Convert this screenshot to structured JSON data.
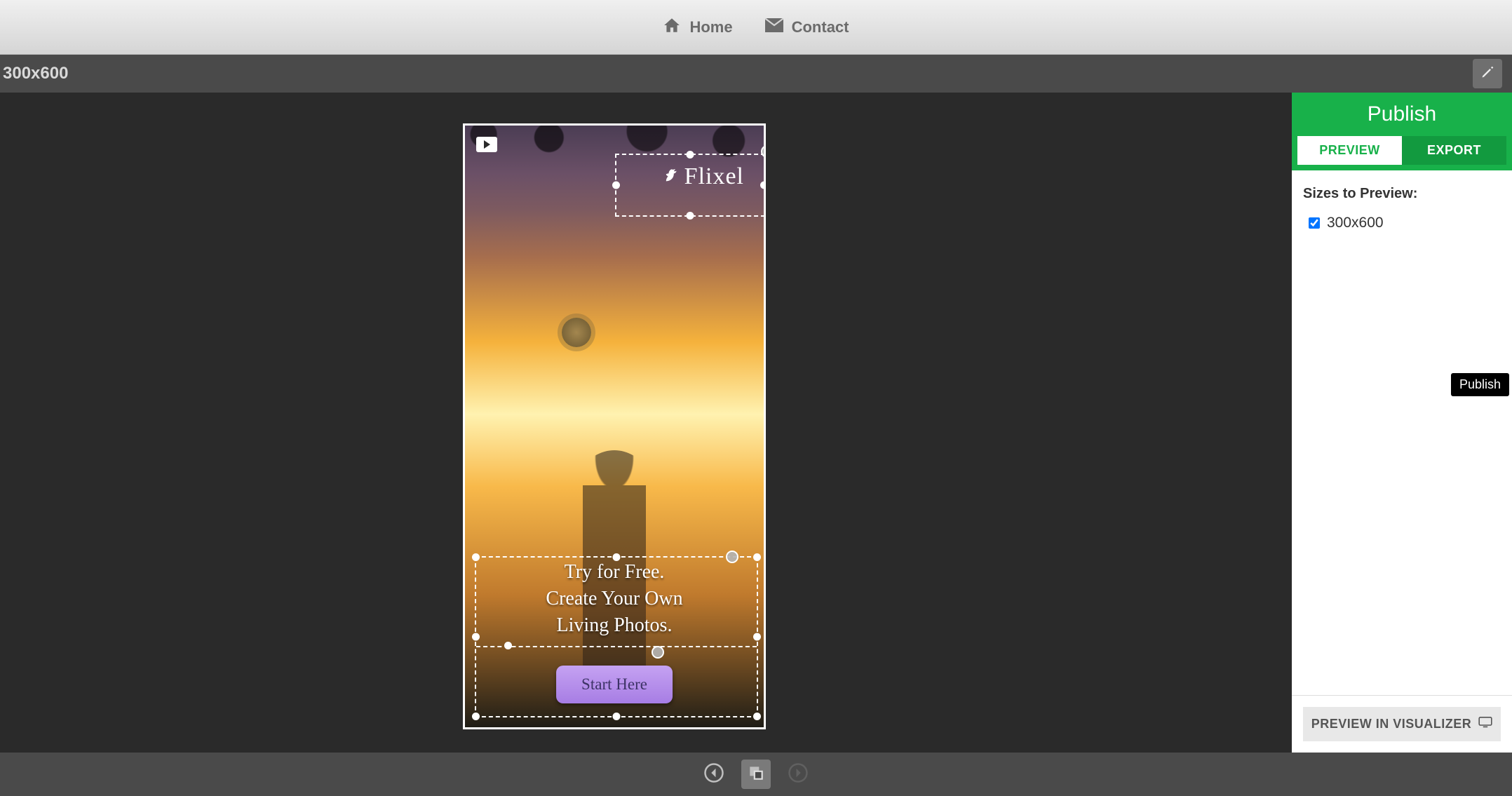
{
  "topnav": {
    "home": "Home",
    "contact": "Contact"
  },
  "docbar": {
    "title": "300x600"
  },
  "ad": {
    "logo_text": "Flixel",
    "copy_line1": "Try for Free.",
    "copy_line2": "Create Your Own",
    "copy_line3": "Living Photos.",
    "cta_label": "Start Here"
  },
  "panel": {
    "header": "Publish",
    "tab_preview": "PREVIEW",
    "tab_export": "EXPORT",
    "sizes_label": "Sizes to Preview:",
    "sizes": [
      {
        "label": "300x600",
        "checked": true
      }
    ],
    "viz_button": "PREVIEW IN VISUALIZER"
  },
  "tooltip": {
    "publish": "Publish"
  },
  "colors": {
    "accent_green": "#18b14a",
    "accent_green_dark": "#129a3f",
    "cta_purple_top": "#c5a2f2",
    "cta_purple_bottom": "#a77de4"
  }
}
